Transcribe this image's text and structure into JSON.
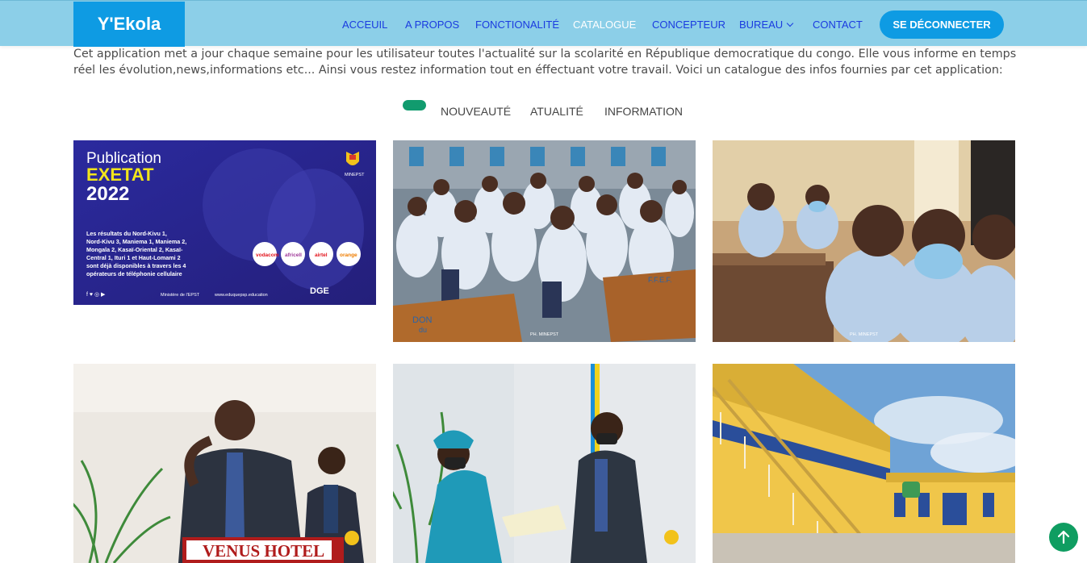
{
  "header": {
    "logo": "Y'Ekola",
    "nav": {
      "accueil": "ACCEUIL",
      "apropos": "A PROPOS",
      "fonctionalite": "FONCTIONALITÉ",
      "catalogue": "CATALOGUE",
      "concepteur": "CONCEPTEUR",
      "bureau": "BUREAU",
      "contact": "CONTACT"
    },
    "logout_label": "SE DÉCONNECTER"
  },
  "intro": "Cet application met a jour chaque semaine pour les utilisateur toutes l'actualité sur la scolarité en République democratique du congo. Elle vous informe en temps réel les évolution,news,informations etc... Ainsi vous restez information tout en éffectuant votre travail. Voici un catalogue des infos fournies par cet application:",
  "filters": {
    "nouveaute": "NOUVEAUTÉ",
    "actualite": "ATUALITÉ",
    "information": "INFORMATION"
  },
  "gallery": {
    "poster": {
      "line1": "Publication",
      "line2": "EXETAT",
      "line3": "2022",
      "body": [
        "Les résultats du Nord-Kivu 1,",
        "Nord-Kivu 3, Maniema 1, Maniema 2,",
        "Mongala 2, Kasaï-Oriental 2, Kasaï-",
        "Central 1, Ituri 1 et Haut-Lomami 2",
        "sont déjà disponibles à travers les 4",
        "opérateurs de téléphonie cellulaire"
      ],
      "minepst": "MINEPST",
      "ministry": "Ministère de l'EPST",
      "website": "www.eduquepsp.education",
      "dge": "DGE",
      "operators": [
        "vodacom",
        "africell",
        "airtel",
        "orange"
      ]
    },
    "photo_credit": "PH. MINEPST",
    "sign_text": "VENUS HOTEL",
    "desk_text_1": "DON",
    "desk_text_2": "du",
    "desk_text_3": "F.F.E.F."
  },
  "colors": {
    "header_bg": "#8ccfe8",
    "brand_blue": "#0e9be3",
    "nav_link": "#1a3be0",
    "filter_active": "#119b6e",
    "to_top": "#0f9d61"
  }
}
